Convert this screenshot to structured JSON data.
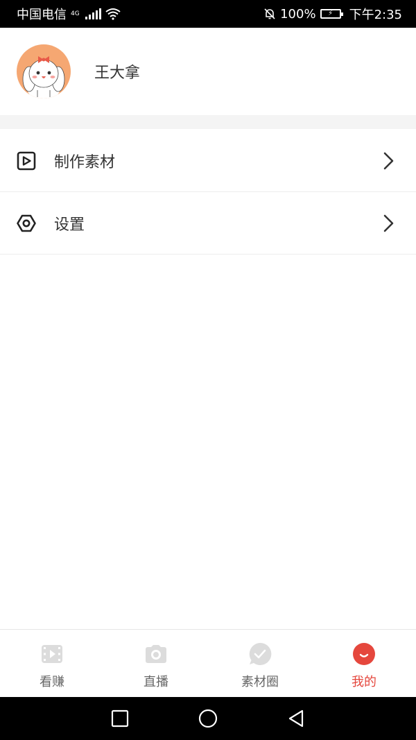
{
  "status_bar": {
    "carrier": "中国电信",
    "network": "4G",
    "battery": "100%",
    "time": "下午2:35"
  },
  "profile": {
    "name": "王大拿"
  },
  "menu": [
    {
      "label": "制作素材",
      "icon": "play-square-icon"
    },
    {
      "label": "设置",
      "icon": "hexagon-settings-icon"
    }
  ],
  "tabs": [
    {
      "label": "看赚",
      "icon": "video-icon",
      "active": false
    },
    {
      "label": "直播",
      "icon": "camera-icon",
      "active": false
    },
    {
      "label": "素材圈",
      "icon": "check-bubble-icon",
      "active": false
    },
    {
      "label": "我的",
      "icon": "smile-icon",
      "active": true
    }
  ],
  "colors": {
    "accent": "#e5473d",
    "avatar_bg": "#f5a772",
    "inactive_icon": "#d9d9d9"
  }
}
